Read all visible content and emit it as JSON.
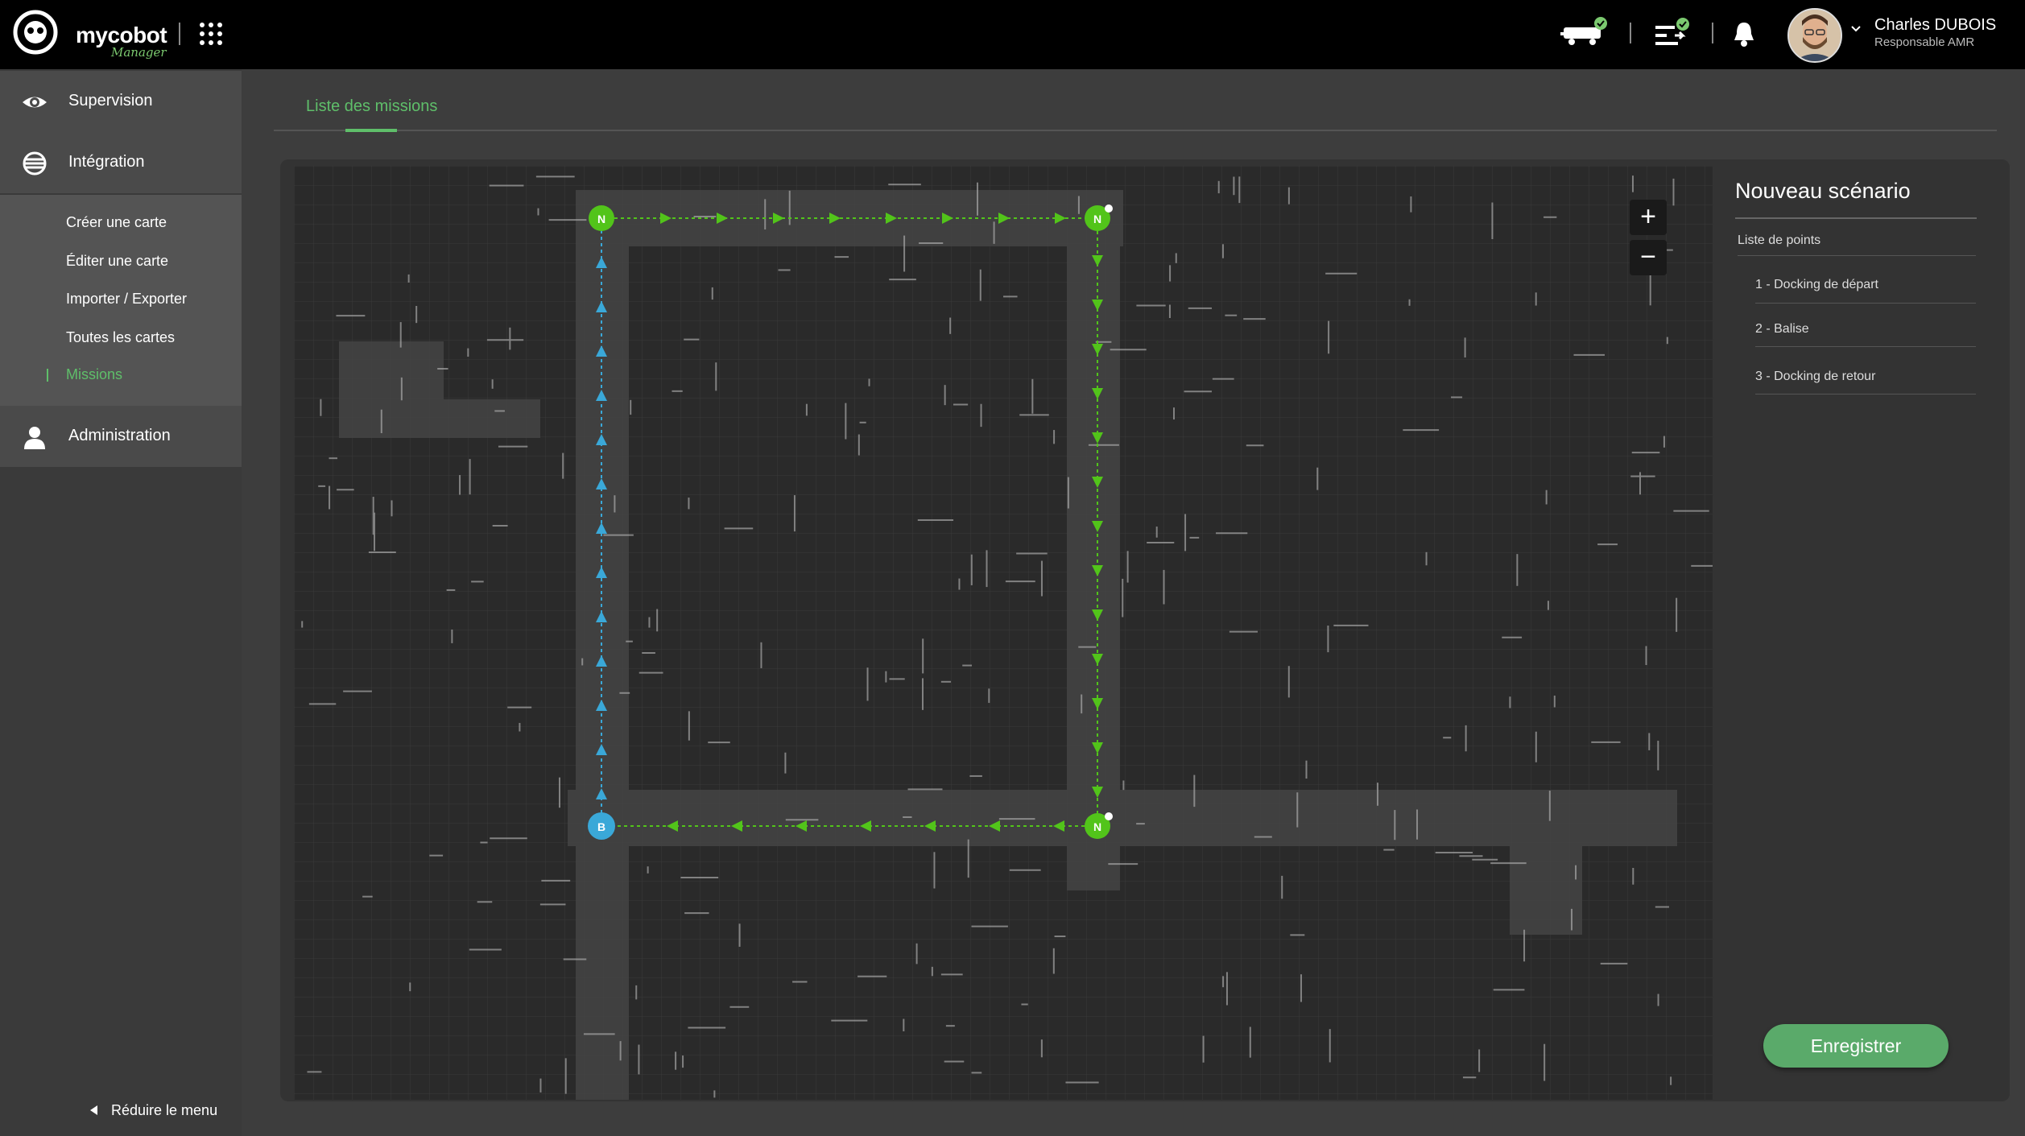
{
  "app": {
    "logo_text": "mycobot",
    "logo_sub": "Manager"
  },
  "header": {
    "user_name": "Charles DUBOIS",
    "user_role": "Responsable AMR",
    "icons": [
      "apps-grid-icon",
      "robot-status-icon",
      "mission-status-icon",
      "bell-icon",
      "avatar",
      "chevron-down-icon"
    ]
  },
  "sidebar": {
    "items": [
      {
        "label": "Supervision",
        "icon": "eye-icon"
      },
      {
        "label": "Intégration",
        "icon": "layers-icon"
      },
      {
        "label": "Administration",
        "icon": "user-icon"
      }
    ],
    "submenu": [
      {
        "label": "Créer une carte"
      },
      {
        "label": "Éditer une carte"
      },
      {
        "label": "Importer / Exporter"
      },
      {
        "label": "Toutes les cartes"
      },
      {
        "label": "Missions",
        "active": true
      }
    ],
    "reduce_label": "Réduire le menu"
  },
  "tabs": [
    {
      "label": "Liste des missions",
      "active": true
    }
  ],
  "map": {
    "zoom_in": "+",
    "zoom_out": "−",
    "markers": [
      {
        "label": "N",
        "color": "#52c41a"
      },
      {
        "label": "N",
        "color": "#52c41a"
      },
      {
        "label": "N",
        "color": "#52c41a"
      },
      {
        "label": "B",
        "color": "#3aa8d8"
      }
    ]
  },
  "panel": {
    "title": "Nouveau scénario",
    "points_label": "Liste de points",
    "points": [
      {
        "label": "1 -  Docking de départ"
      },
      {
        "label": "2 - Balise"
      },
      {
        "label": "3 - Docking de retour"
      }
    ],
    "save_label": "Enregistrer"
  },
  "colors": {
    "accent": "#5fbf6a",
    "route_green": "#52c41a",
    "route_blue": "#3aa8d8",
    "topbar": "#000000"
  }
}
